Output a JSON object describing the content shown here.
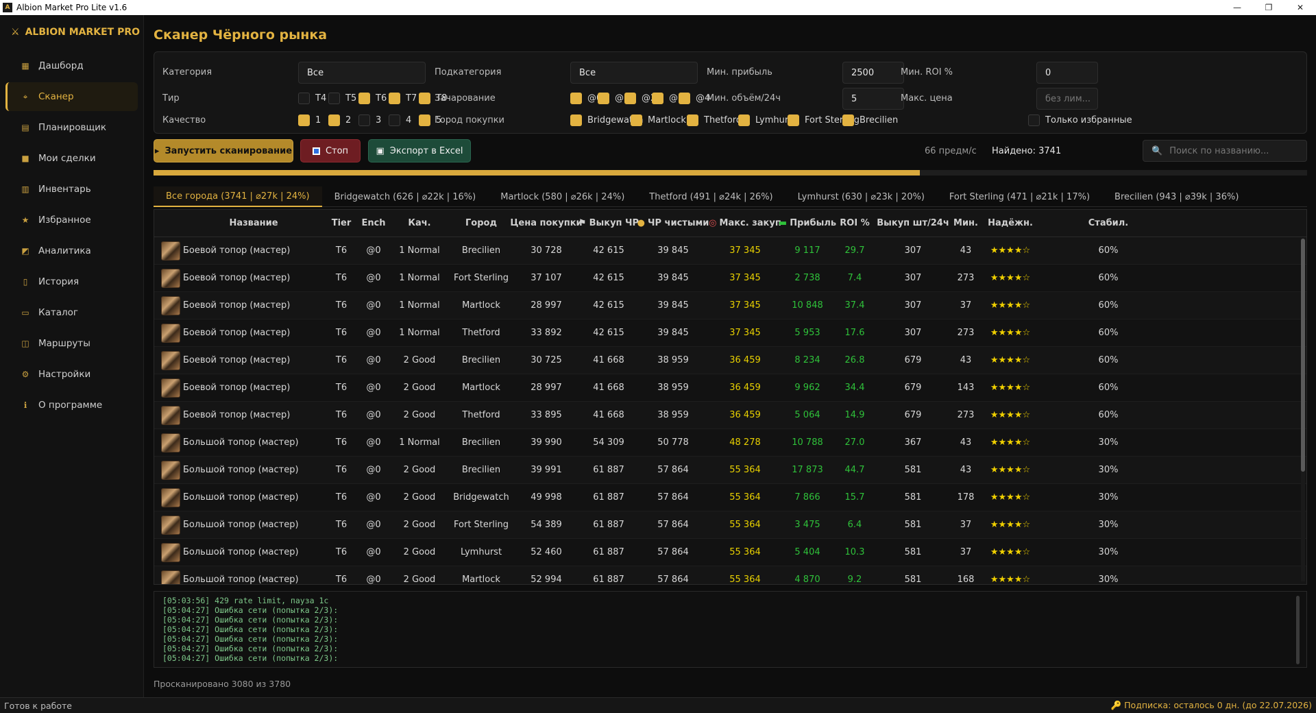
{
  "window": {
    "title": "Albion Market Pro Lite  v1.6",
    "min": "—",
    "max": "❐",
    "close": "✕"
  },
  "sidebar": {
    "brand": "ALBION MARKET PRO",
    "items": [
      {
        "label": "Дашборд",
        "icon": "dashboard-icon",
        "glyph": "▦"
      },
      {
        "label": "Сканер",
        "icon": "scanner-icon",
        "glyph": "⌖",
        "active": true
      },
      {
        "label": "Планировщик",
        "icon": "planner-icon",
        "glyph": "▤"
      },
      {
        "label": "Мои сделки",
        "icon": "deals-icon",
        "glyph": "■"
      },
      {
        "label": "Инвентарь",
        "icon": "inventory-icon",
        "glyph": "▥"
      },
      {
        "label": "Избранное",
        "icon": "star-icon",
        "glyph": "★"
      },
      {
        "label": "Аналитика",
        "icon": "chart-icon",
        "glyph": "◩"
      },
      {
        "label": "История",
        "icon": "history-icon",
        "glyph": "▯"
      },
      {
        "label": "Каталог",
        "icon": "catalog-icon",
        "glyph": "▭"
      },
      {
        "label": "Маршруты",
        "icon": "routes-icon",
        "glyph": "◫"
      },
      {
        "label": "Настройки",
        "icon": "gear-icon",
        "glyph": "⚙"
      },
      {
        "label": "О программе",
        "icon": "info-icon",
        "glyph": "ℹ"
      }
    ]
  },
  "page": {
    "title": "Сканер Чёрного рынка"
  },
  "filters": {
    "category_label": "Категория",
    "category_value": "Все",
    "subcategory_label": "Подкатегория",
    "subcategory_value": "Все",
    "min_profit_label": "Мин. прибыль",
    "min_profit_value": "2500",
    "min_roi_label": "Мин. ROI %",
    "min_roi_value": "0",
    "tier_label": "Тир",
    "tiers": [
      {
        "label": "T4",
        "on": false
      },
      {
        "label": "T5",
        "on": false
      },
      {
        "label": "T6",
        "on": true
      },
      {
        "label": "T7",
        "on": true
      },
      {
        "label": "T8",
        "on": true
      }
    ],
    "ench_label": "Зачарование",
    "enchants": [
      {
        "label": "@0",
        "on": true
      },
      {
        "label": "@1",
        "on": true
      },
      {
        "label": "@2",
        "on": true
      },
      {
        "label": "@3",
        "on": true
      },
      {
        "label": "@4",
        "on": true
      }
    ],
    "min_volume_label": "Мин. объём/24ч",
    "min_volume_value": "5",
    "max_price_label": "Макс. цена",
    "max_price_placeholder": "без лим...",
    "quality_label": "Качество",
    "qualities": [
      {
        "label": "1",
        "on": true
      },
      {
        "label": "2",
        "on": true
      },
      {
        "label": "3",
        "on": false
      },
      {
        "label": "4",
        "on": false
      },
      {
        "label": "5",
        "on": true
      }
    ],
    "city_label": "Город покупки",
    "cities": [
      {
        "label": "Bridgewatch",
        "on": true
      },
      {
        "label": "Martlock",
        "on": true
      },
      {
        "label": "Thetford",
        "on": true
      },
      {
        "label": "Lymhurst",
        "on": true
      },
      {
        "label": "Fort Sterling",
        "on": true
      },
      {
        "label": "Brecilien",
        "on": true
      }
    ],
    "favorites_only": {
      "label": "Только избранные",
      "on": false
    }
  },
  "actions": {
    "start": "Запустить сканирование",
    "stop": "Стоп",
    "export": "Экспорт в Excel",
    "speed": "66 предм/с",
    "found": "Найдено: 3741",
    "search_placeholder": "Поиск по названию..."
  },
  "progress": {
    "fraction": 0.664
  },
  "tabs": [
    "Все города (3741 | ⌀27k | 24%)",
    "Bridgewatch (626 | ⌀22k | 16%)",
    "Martlock (580 | ⌀26k | 24%)",
    "Thetford (491 | ⌀24k | 26%)",
    "Lymhurst (630 | ⌀23k | 20%)",
    "Fort Sterling (471 | ⌀21k | 17%)",
    "Brecilien (943 | ⌀39k | 36%)"
  ],
  "table": {
    "headers": {
      "name": "Название",
      "tier": "Tier",
      "ench": "Ench",
      "quality": "Кач.",
      "city": "Город",
      "buy": "Цена покупки",
      "bm": "Выкуп ЧР",
      "net": "ЧР чистыми",
      "max": "Макс. закуп",
      "profit": "Прибыль",
      "roi": "ROI %",
      "vol": "Выкуп шт/24ч",
      "min": "Мин.",
      "rel": "Надёжн.",
      "stab": "Стабил."
    },
    "rows": [
      {
        "name": "Боевой топор (мастер)",
        "tier": "T6",
        "ench": "@0",
        "q": "1 Normal",
        "city": "Brecilien",
        "buy": "30 728",
        "bm": "42 615",
        "net": "39 845",
        "max": "37 345",
        "profit": "9 117",
        "roi": "29.7",
        "vol": "307",
        "min": "43",
        "rel": "★★★★☆",
        "stab": "60%"
      },
      {
        "name": "Боевой топор (мастер)",
        "tier": "T6",
        "ench": "@0",
        "q": "1 Normal",
        "city": "Fort Sterling",
        "buy": "37 107",
        "bm": "42 615",
        "net": "39 845",
        "max": "37 345",
        "profit": "2 738",
        "roi": "7.4",
        "vol": "307",
        "min": "273",
        "rel": "★★★★☆",
        "stab": "60%"
      },
      {
        "name": "Боевой топор (мастер)",
        "tier": "T6",
        "ench": "@0",
        "q": "1 Normal",
        "city": "Martlock",
        "buy": "28 997",
        "bm": "42 615",
        "net": "39 845",
        "max": "37 345",
        "profit": "10 848",
        "roi": "37.4",
        "vol": "307",
        "min": "37",
        "rel": "★★★★☆",
        "stab": "60%"
      },
      {
        "name": "Боевой топор (мастер)",
        "tier": "T6",
        "ench": "@0",
        "q": "1 Normal",
        "city": "Thetford",
        "buy": "33 892",
        "bm": "42 615",
        "net": "39 845",
        "max": "37 345",
        "profit": "5 953",
        "roi": "17.6",
        "vol": "307",
        "min": "273",
        "rel": "★★★★☆",
        "stab": "60%"
      },
      {
        "name": "Боевой топор (мастер)",
        "tier": "T6",
        "ench": "@0",
        "q": "2 Good",
        "city": "Brecilien",
        "buy": "30 725",
        "bm": "41 668",
        "net": "38 959",
        "max": "36 459",
        "profit": "8 234",
        "roi": "26.8",
        "vol": "679",
        "min": "43",
        "rel": "★★★★☆",
        "stab": "60%"
      },
      {
        "name": "Боевой топор (мастер)",
        "tier": "T6",
        "ench": "@0",
        "q": "2 Good",
        "city": "Martlock",
        "buy": "28 997",
        "bm": "41 668",
        "net": "38 959",
        "max": "36 459",
        "profit": "9 962",
        "roi": "34.4",
        "vol": "679",
        "min": "143",
        "rel": "★★★★☆",
        "stab": "60%"
      },
      {
        "name": "Боевой топор (мастер)",
        "tier": "T6",
        "ench": "@0",
        "q": "2 Good",
        "city": "Thetford",
        "buy": "33 895",
        "bm": "41 668",
        "net": "38 959",
        "max": "36 459",
        "profit": "5 064",
        "roi": "14.9",
        "vol": "679",
        "min": "273",
        "rel": "★★★★☆",
        "stab": "60%"
      },
      {
        "name": "Большой топор (мастер)",
        "tier": "T6",
        "ench": "@0",
        "q": "1 Normal",
        "city": "Brecilien",
        "buy": "39 990",
        "bm": "54 309",
        "net": "50 778",
        "max": "48 278",
        "profit": "10 788",
        "roi": "27.0",
        "vol": "367",
        "min": "43",
        "rel": "★★★★☆",
        "stab": "30%"
      },
      {
        "name": "Большой топор (мастер)",
        "tier": "T6",
        "ench": "@0",
        "q": "2 Good",
        "city": "Brecilien",
        "buy": "39 991",
        "bm": "61 887",
        "net": "57 864",
        "max": "55 364",
        "profit": "17 873",
        "roi": "44.7",
        "vol": "581",
        "min": "43",
        "rel": "★★★★☆",
        "stab": "30%"
      },
      {
        "name": "Большой топор (мастер)",
        "tier": "T6",
        "ench": "@0",
        "q": "2 Good",
        "city": "Bridgewatch",
        "buy": "49 998",
        "bm": "61 887",
        "net": "57 864",
        "max": "55 364",
        "profit": "7 866",
        "roi": "15.7",
        "vol": "581",
        "min": "178",
        "rel": "★★★★☆",
        "stab": "30%"
      },
      {
        "name": "Большой топор (мастер)",
        "tier": "T6",
        "ench": "@0",
        "q": "2 Good",
        "city": "Fort Sterling",
        "buy": "54 389",
        "bm": "61 887",
        "net": "57 864",
        "max": "55 364",
        "profit": "3 475",
        "roi": "6.4",
        "vol": "581",
        "min": "37",
        "rel": "★★★★☆",
        "stab": "30%"
      },
      {
        "name": "Большой топор (мастер)",
        "tier": "T6",
        "ench": "@0",
        "q": "2 Good",
        "city": "Lymhurst",
        "buy": "52 460",
        "bm": "61 887",
        "net": "57 864",
        "max": "55 364",
        "profit": "5 404",
        "roi": "10.3",
        "vol": "581",
        "min": "37",
        "rel": "★★★★☆",
        "stab": "30%"
      },
      {
        "name": "Большой топор (мастер)",
        "tier": "T6",
        "ench": "@0",
        "q": "2 Good",
        "city": "Martlock",
        "buy": "52 994",
        "bm": "61 887",
        "net": "57 864",
        "max": "55 364",
        "profit": "4 870",
        "roi": "9.2",
        "vol": "581",
        "min": "168",
        "rel": "★★★★☆",
        "stab": "30%"
      }
    ]
  },
  "log": [
    "[05:03:56] 429 rate limit, пауза 1с",
    "[05:04:27] Ошибка сети (попытка 2/3):",
    "[05:04:27] Ошибка сети (попытка 2/3):",
    "[05:04:27] Ошибка сети (попытка 2/3):",
    "[05:04:27] Ошибка сети (попытка 2/3):",
    "[05:04:27] Ошибка сети (попытка 2/3):",
    "[05:04:27] Ошибка сети (попытка 2/3):"
  ],
  "scanned": "Просканировано 3080 из 3780",
  "status": {
    "left": "Готов к работе",
    "right": "🔑 Подписка: осталось 0 дн. (до 22.07.2026)"
  },
  "colors": {
    "accent": "#e3b341",
    "profit": "#2fc23a",
    "max_buy": "#e8d000",
    "background": "#0d0d0d"
  }
}
